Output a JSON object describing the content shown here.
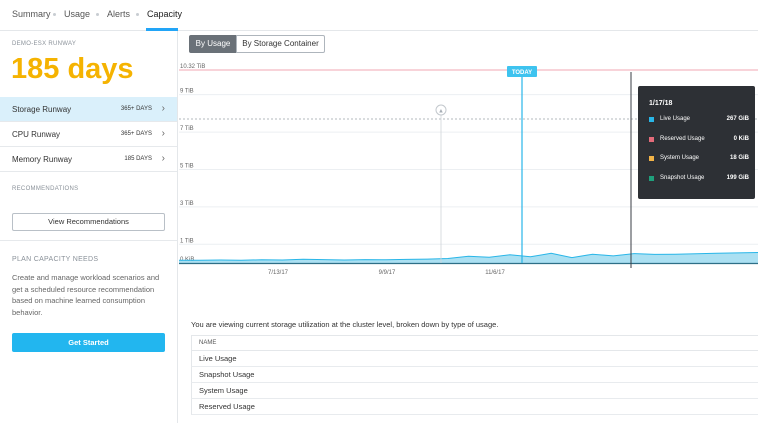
{
  "tabs": [
    "Summary",
    "Usage",
    "Alerts",
    "Capacity"
  ],
  "sidebar": {
    "cluster_name": "DEMO-ESX RUNWAY",
    "runway": "185 days",
    "rows": [
      {
        "label": "Storage Runway",
        "value": "365+ DAYS"
      },
      {
        "label": "CPU Runway",
        "value": "365+ DAYS"
      },
      {
        "label": "Memory Runway",
        "value": "185 DAYS"
      }
    ],
    "recommendations_heading": "RECOMMENDATIONS",
    "view_recommendations": "View Recommendations",
    "plan_heading": "PLAN CAPACITY NEEDS",
    "plan_text": "Create and manage workload scenarios and get a scheduled resource recommendation based on machine learned consumption behavior.",
    "get_started": "Get Started"
  },
  "toggle": {
    "by_usage": "By Usage",
    "by_container": "By Storage Container"
  },
  "tooltip": {
    "date": "1/17/18",
    "rows": [
      {
        "label": "Live Usage",
        "value": "267 GiB",
        "color": "#29b6e8"
      },
      {
        "label": "Reserved Usage",
        "value": "0 KiB",
        "color": "#e46b7a"
      },
      {
        "label": "System Usage",
        "value": "18 GiB",
        "color": "#f2b347"
      },
      {
        "label": "Snapshot Usage",
        "value": "199 GiB",
        "color": "#1fa07c"
      }
    ]
  },
  "description": "You are viewing current storage utilization at the cluster level, broken down by type of usage.",
  "table": {
    "header": "NAME",
    "rows": [
      "Live Usage",
      "Snapshot Usage",
      "System Usage",
      "Reserved Usage"
    ]
  },
  "chart_data": {
    "type": "area",
    "y_ticks": [
      "0 KiB",
      "1 TiB",
      "3 TiB",
      "5 TiB",
      "7 TiB",
      "9 TiB",
      "10.32 TiB"
    ],
    "y_tick_values_tib": [
      0,
      1,
      3,
      5,
      7,
      9,
      10.32
    ],
    "x_ticks": [
      "7/13/17",
      "9/9/17",
      "11/6/17"
    ],
    "today_label": "TODAY",
    "capacity_tib": 10.32,
    "threshold_tib": 7.7,
    "series_color": "#29b6e8",
    "usage_tib": [
      0.15,
      0.15,
      0.16,
      0.15,
      0.17,
      0.16,
      0.2,
      0.18,
      0.16,
      0.18,
      0.17,
      0.19,
      0.21,
      0.24,
      0.36,
      0.31,
      0.44,
      0.33,
      0.52,
      0.29,
      0.47,
      0.38,
      0.5,
      0.46,
      0.47,
      0.49,
      0.52,
      0.54,
      0.56
    ]
  }
}
